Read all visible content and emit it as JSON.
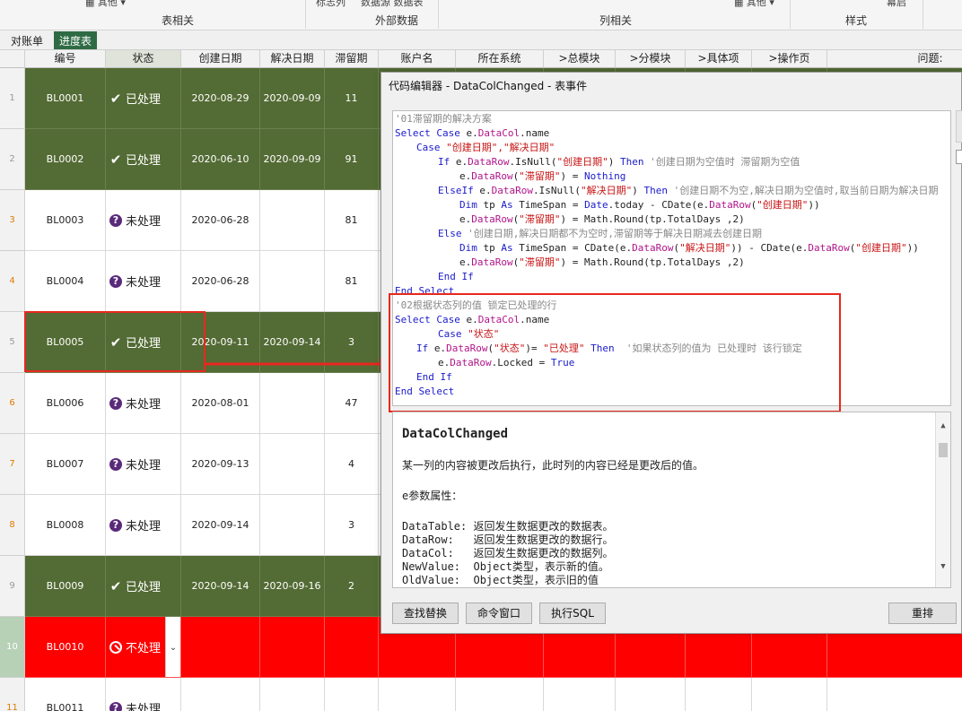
{
  "ribbon": {
    "top_items": [
      {
        "label": "其他"
      },
      {
        "label": "标志列"
      },
      {
        "label": "数据源 数据表"
      },
      {
        "label": "其他"
      },
      {
        "label": "幕启"
      }
    ],
    "groups": [
      "表相关",
      "外部数据",
      "列相关",
      "样式"
    ]
  },
  "tabs": [
    {
      "label": "对账单"
    },
    {
      "label": "进度表"
    }
  ],
  "columns": [
    "编号",
    "状态",
    "创建日期",
    "解决日期",
    "滞留期",
    "账户名",
    "所在系统",
    ">总模块",
    ">分模块",
    ">具体项",
    ">操作页",
    "问题:"
  ],
  "rows": [
    {
      "num": "1",
      "id": "BL0001",
      "status": "已处理",
      "created": "2020-08-29",
      "resolved": "2020-09-09",
      "days": "11"
    },
    {
      "num": "2",
      "id": "BL0002",
      "status": "已处理",
      "created": "2020-06-10",
      "resolved": "2020-09-09",
      "days": "91"
    },
    {
      "num": "3",
      "id": "BL0003",
      "status": "未处理",
      "created": "2020-06-28",
      "resolved": "",
      "days": "81"
    },
    {
      "num": "4",
      "id": "BL0004",
      "status": "未处理",
      "created": "2020-06-28",
      "resolved": "",
      "days": "81"
    },
    {
      "num": "5",
      "id": "BL0005",
      "status": "已处理",
      "created": "2020-09-11",
      "resolved": "2020-09-14",
      "days": "3"
    },
    {
      "num": "6",
      "id": "BL0006",
      "status": "未处理",
      "created": "2020-08-01",
      "resolved": "",
      "days": "47"
    },
    {
      "num": "7",
      "id": "BL0007",
      "status": "未处理",
      "created": "2020-09-13",
      "resolved": "",
      "days": "4"
    },
    {
      "num": "8",
      "id": "BL0008",
      "status": "未处理",
      "created": "2020-09-14",
      "resolved": "",
      "days": "3"
    },
    {
      "num": "9",
      "id": "BL0009",
      "status": "已处理",
      "created": "2020-09-14",
      "resolved": "2020-09-16",
      "days": "2"
    },
    {
      "num": "10",
      "id": "BL0010",
      "status": "不处理",
      "created": "",
      "resolved": "",
      "days": ""
    },
    {
      "num": "11",
      "id": "BL0011",
      "status": "未处理",
      "created": "",
      "resolved": "",
      "days": ""
    }
  ],
  "dialog": {
    "title": "代码编辑器 - DataColChanged - 表事件",
    "help_title": "DataColChanged",
    "help_lines": [
      "某一列的内容被更改后执行，此时列的内容已经是更改后的值。",
      "e参数属性：",
      "DataTable: 返回发生数据更改的数据表。",
      "DataRow:   返回发生数据更改的数据行。",
      "DataCol:   返回发生数据更改的数据列。",
      "NewValue:  Object类型，表示新的值。",
      "OldValue:  Object类型，表示旧的值"
    ],
    "buttons": [
      "查找替换",
      "命令窗口",
      "执行SQL",
      "重排"
    ]
  },
  "code_lines": [
    {
      "indent": 0,
      "parts": [
        {
          "c": "cm",
          "t": "'01滞留期的解决方案"
        }
      ]
    },
    {
      "indent": 0,
      "parts": [
        {
          "c": "kw",
          "t": "Select Case "
        },
        {
          "c": "tx",
          "t": "e."
        },
        {
          "c": "mem",
          "t": "DataCol"
        },
        {
          "c": "tx",
          "t": ".name"
        }
      ]
    },
    {
      "indent": 1,
      "parts": [
        {
          "c": "kw",
          "t": "Case "
        },
        {
          "c": "str",
          "t": "\"创建日期\",\"解决日期\""
        }
      ]
    },
    {
      "indent": 2,
      "parts": [
        {
          "c": "kw",
          "t": "If "
        },
        {
          "c": "tx",
          "t": "e."
        },
        {
          "c": "mem",
          "t": "DataRow"
        },
        {
          "c": "tx",
          "t": ".IsNull("
        },
        {
          "c": "str",
          "t": "\"创建日期\""
        },
        {
          "c": "tx",
          "t": ") "
        },
        {
          "c": "kw",
          "t": "Then "
        },
        {
          "c": "cm",
          "t": "'创建日期为空值时 滞留期为空值"
        }
      ]
    },
    {
      "indent": 3,
      "parts": [
        {
          "c": "tx",
          "t": "e."
        },
        {
          "c": "mem",
          "t": "DataRow"
        },
        {
          "c": "tx",
          "t": "("
        },
        {
          "c": "str",
          "t": "\"滞留期\""
        },
        {
          "c": "tx",
          "t": ") = "
        },
        {
          "c": "kw",
          "t": "Nothing"
        }
      ]
    },
    {
      "indent": 2,
      "parts": [
        {
          "c": "kw",
          "t": "ElseIf "
        },
        {
          "c": "tx",
          "t": "e."
        },
        {
          "c": "mem",
          "t": "DataRow"
        },
        {
          "c": "tx",
          "t": ".IsNull("
        },
        {
          "c": "str",
          "t": "\"解决日期\""
        },
        {
          "c": "tx",
          "t": ") "
        },
        {
          "c": "kw",
          "t": "Then "
        },
        {
          "c": "cm",
          "t": "'创建日期不为空,解决日期为空值时,取当前日期为解决日期"
        }
      ]
    },
    {
      "indent": 3,
      "parts": [
        {
          "c": "kw",
          "t": "Dim "
        },
        {
          "c": "tx",
          "t": "tp "
        },
        {
          "c": "kw",
          "t": "As "
        },
        {
          "c": "tx",
          "t": "TimeSpan = "
        },
        {
          "c": "kw",
          "t": "Date"
        },
        {
          "c": "tx",
          "t": ".today - CDate(e."
        },
        {
          "c": "mem",
          "t": "DataRow"
        },
        {
          "c": "tx",
          "t": "("
        },
        {
          "c": "str",
          "t": "\"创建日期\""
        },
        {
          "c": "tx",
          "t": "))"
        }
      ]
    },
    {
      "indent": 3,
      "parts": [
        {
          "c": "tx",
          "t": "e."
        },
        {
          "c": "mem",
          "t": "DataRow"
        },
        {
          "c": "tx",
          "t": "("
        },
        {
          "c": "str",
          "t": "\"滞留期\""
        },
        {
          "c": "tx",
          "t": ") = Math.Round(tp.TotalDays ,2)"
        }
      ]
    },
    {
      "indent": 2,
      "parts": [
        {
          "c": "kw",
          "t": "Else "
        },
        {
          "c": "cm",
          "t": "'创建日期,解决日期都不为空时,滞留期等于解决日期减去创建日期"
        }
      ]
    },
    {
      "indent": 3,
      "parts": [
        {
          "c": "kw",
          "t": "Dim "
        },
        {
          "c": "tx",
          "t": "tp "
        },
        {
          "c": "kw",
          "t": "As "
        },
        {
          "c": "tx",
          "t": "TimeSpan = CDate(e."
        },
        {
          "c": "mem",
          "t": "DataRow"
        },
        {
          "c": "tx",
          "t": "("
        },
        {
          "c": "str",
          "t": "\"解决日期\""
        },
        {
          "c": "tx",
          "t": ")) - CDate(e."
        },
        {
          "c": "mem",
          "t": "DataRow"
        },
        {
          "c": "tx",
          "t": "("
        },
        {
          "c": "str",
          "t": "\"创建日期\""
        },
        {
          "c": "tx",
          "t": "))"
        }
      ]
    },
    {
      "indent": 3,
      "parts": [
        {
          "c": "tx",
          "t": "e."
        },
        {
          "c": "mem",
          "t": "DataRow"
        },
        {
          "c": "tx",
          "t": "("
        },
        {
          "c": "str",
          "t": "\"滞留期\""
        },
        {
          "c": "tx",
          "t": ") = Math.Round(tp.TotalDays ,2)"
        }
      ]
    },
    {
      "indent": 2,
      "parts": [
        {
          "c": "kw",
          "t": "End If"
        }
      ]
    },
    {
      "indent": 0,
      "parts": [
        {
          "c": "kw",
          "t": "End Select"
        }
      ]
    },
    {
      "indent": 0,
      "parts": [
        {
          "c": "cm",
          "t": "'02根据状态列的值 锁定已处理的行"
        }
      ]
    },
    {
      "indent": 0,
      "parts": [
        {
          "c": "kw",
          "t": "Select Case "
        },
        {
          "c": "tx",
          "t": "e."
        },
        {
          "c": "mem",
          "t": "DataCol"
        },
        {
          "c": "tx",
          "t": ".name"
        }
      ]
    },
    {
      "indent": 2,
      "parts": [
        {
          "c": "kw",
          "t": "Case "
        },
        {
          "c": "str",
          "t": "\"状态\""
        }
      ]
    },
    {
      "indent": 1,
      "parts": [
        {
          "c": "kw",
          "t": "If "
        },
        {
          "c": "tx",
          "t": "e."
        },
        {
          "c": "mem",
          "t": "DataRow"
        },
        {
          "c": "tx",
          "t": "("
        },
        {
          "c": "str",
          "t": "\"状态\""
        },
        {
          "c": "tx",
          "t": ")= "
        },
        {
          "c": "str",
          "t": "\"已处理\""
        },
        {
          "c": "tx",
          "t": " "
        },
        {
          "c": "kw",
          "t": "Then"
        },
        {
          "c": "tx",
          "t": "  "
        },
        {
          "c": "cm",
          "t": "'如果状态列的值为 已处理时 该行锁定"
        }
      ]
    },
    {
      "indent": 2,
      "parts": [
        {
          "c": "tx",
          "t": "e."
        },
        {
          "c": "mem",
          "t": "DataRow"
        },
        {
          "c": "tx",
          "t": ".Locked = "
        },
        {
          "c": "kw",
          "t": "True"
        }
      ]
    },
    {
      "indent": 1,
      "parts": [
        {
          "c": "kw",
          "t": "End If"
        }
      ]
    },
    {
      "indent": 0,
      "parts": [
        {
          "c": "kw",
          "t": "End Select"
        }
      ]
    }
  ],
  "colors": {
    "processed": "#536b34",
    "rejected": "#ff0000",
    "highlight": "#e8281e",
    "tab_active": "#2e6b44"
  },
  "icons": {
    "processed": "check-icon",
    "pending": "question-icon",
    "rejected": "prohibited-icon"
  }
}
